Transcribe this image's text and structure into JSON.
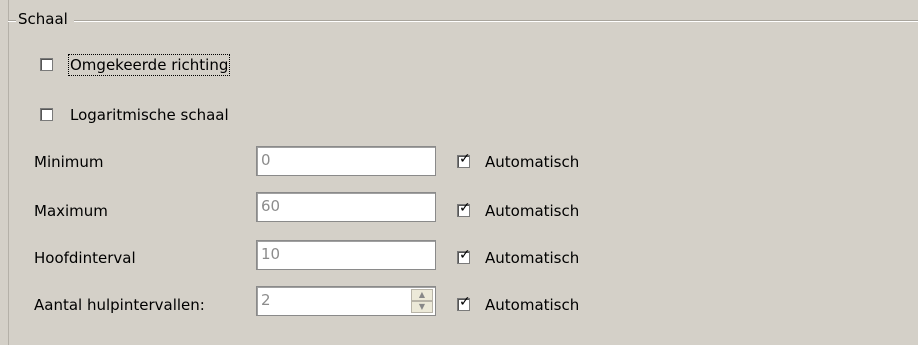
{
  "group": {
    "title": "Schaal"
  },
  "options": {
    "reverse": {
      "label": "Omgekeerde richting",
      "checked": false
    },
    "log": {
      "label": "Logaritmische schaal",
      "checked": false
    }
  },
  "fields": [
    {
      "label": "Minimum",
      "value": "0",
      "auto_label": "Automatisch",
      "auto_checked": true
    },
    {
      "label": "Maximum",
      "value": "60",
      "auto_label": "Automatisch",
      "auto_checked": true
    },
    {
      "label": "Hoofdinterval",
      "value": "10",
      "auto_label": "Automatisch",
      "auto_checked": true
    },
    {
      "label": "Aantal hulpintervallen:",
      "value": "2",
      "auto_label": "Automatisch",
      "auto_checked": true
    }
  ],
  "icons": {
    "spin_up": "spin-up-icon",
    "spin_down": "spin-down-icon",
    "check": "checkmark-icon"
  }
}
